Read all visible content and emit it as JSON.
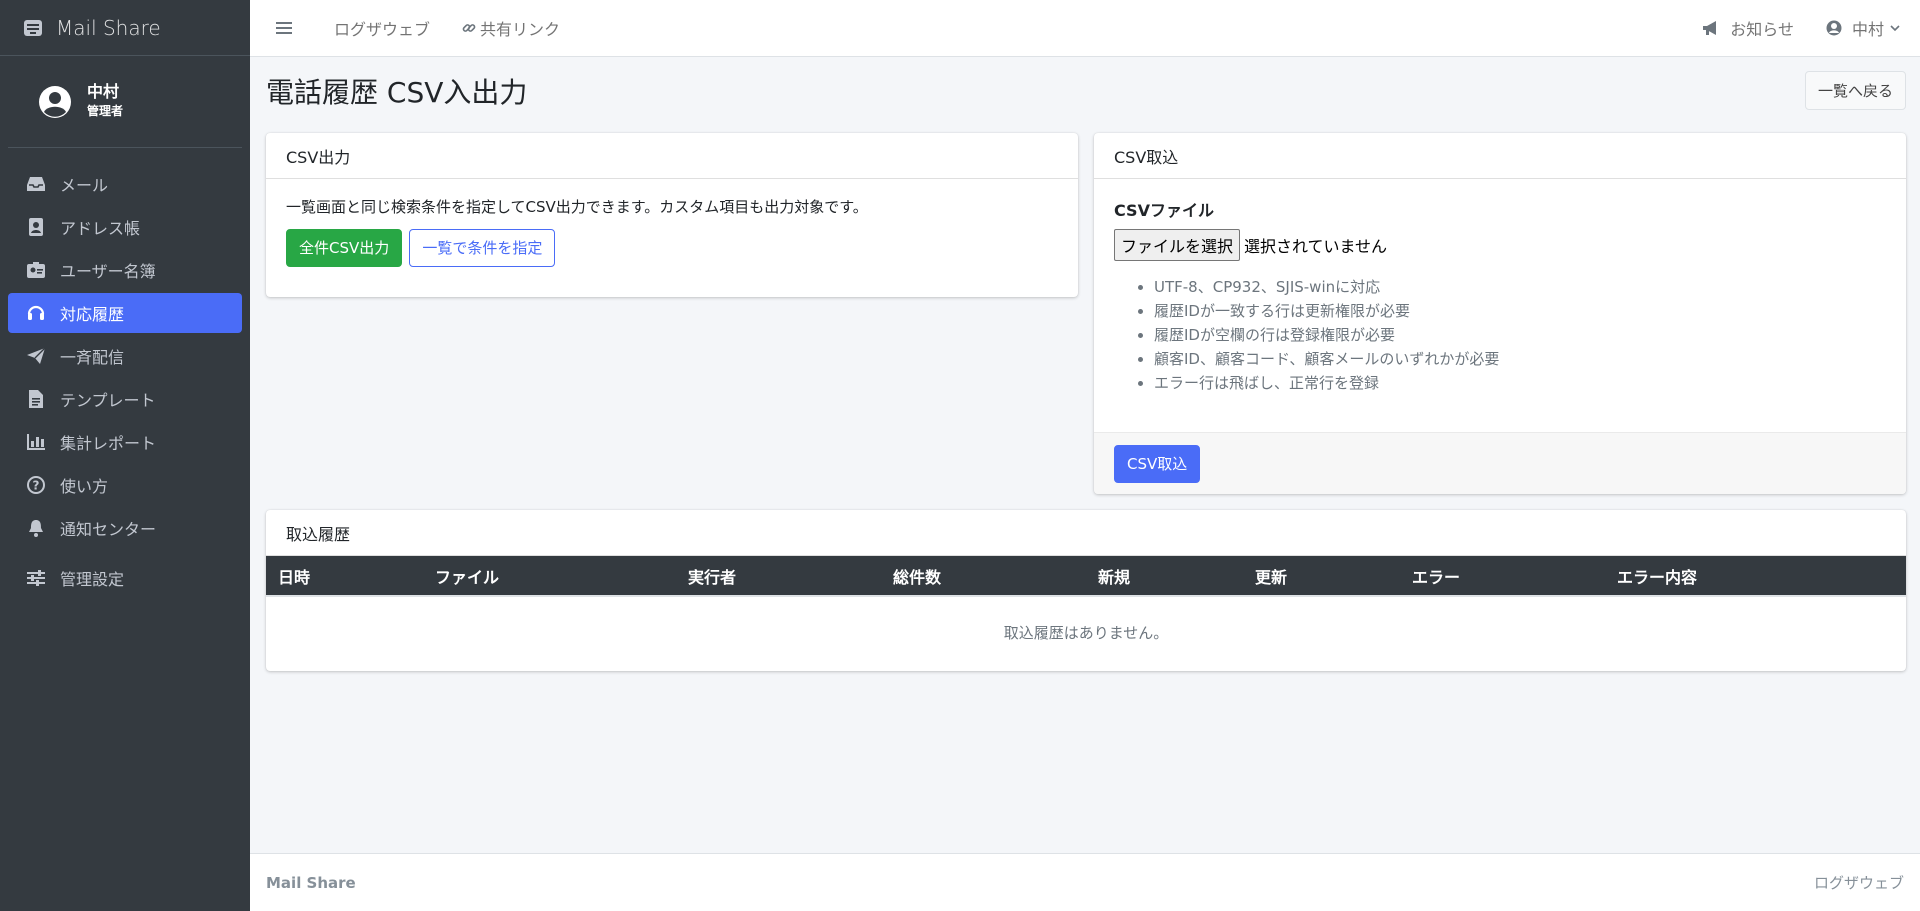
{
  "brand": {
    "name": "Mail Share",
    "icon": "mailbox-icon"
  },
  "user": {
    "name": "中村",
    "role": "管理者"
  },
  "sidebar": {
    "items": [
      {
        "label": "メール",
        "icon": "inbox-icon",
        "active": false
      },
      {
        "label": "アドレス帳",
        "icon": "address-book-icon",
        "active": false
      },
      {
        "label": "ユーザー名簿",
        "icon": "id-badge-icon",
        "active": false
      },
      {
        "label": "対応履歴",
        "icon": "headset-icon",
        "active": true
      },
      {
        "label": "一斉配信",
        "icon": "paper-plane-icon",
        "active": false
      },
      {
        "label": "テンプレート",
        "icon": "file-icon",
        "active": false
      },
      {
        "label": "集計レポート",
        "icon": "chart-bar-icon",
        "active": false
      },
      {
        "label": "使い方",
        "icon": "question-circle-icon",
        "active": false
      },
      {
        "label": "通知センター",
        "icon": "bell-icon",
        "active": false
      },
      {
        "label": "管理設定",
        "icon": "sliders-icon",
        "active": false
      }
    ]
  },
  "topbar": {
    "logout": "ログザウェブ",
    "share_link": "共有リンク",
    "notices": "お知らせ",
    "user": "中村"
  },
  "page": {
    "title": "電話履歴 CSV入出力",
    "back_button": "一覧へ戻る"
  },
  "export_card": {
    "header": "CSV出力",
    "description": "一覧画面と同じ検索条件を指定してCSV出力できます。カスタム項目も出力対象です。",
    "all_button": "全件CSV出力",
    "filter_button": "一覧で条件を指定"
  },
  "import_card": {
    "header": "CSV取込",
    "field_label": "CSVファイル",
    "file_button": "ファイルを選択",
    "file_status": "選択されていません",
    "help": [
      "UTF-8、CP932、SJIS-winに対応",
      "履歴IDが一致する行は更新権限が必要",
      "履歴IDが空欄の行は登録権限が必要",
      "顧客ID、顧客コード、顧客メールのいずれかが必要",
      "エラー行は飛ばし、正常行を登録"
    ],
    "submit_button": "CSV取込"
  },
  "history_card": {
    "header": "取込履歴",
    "columns": [
      "日時",
      "ファイル",
      "実行者",
      "総件数",
      "新規",
      "更新",
      "エラー",
      "エラー内容"
    ],
    "empty": "取込履歴はありません。"
  },
  "footer": {
    "brand": "Mail Share",
    "link": "ログザウェブ"
  }
}
